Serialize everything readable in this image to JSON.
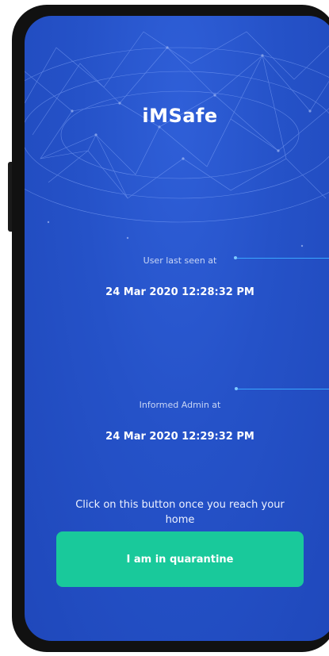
{
  "app": {
    "title": "iMSafe"
  },
  "last_seen": {
    "label": "User last seen at",
    "value": "24 Mar 2020 12:28:32 PM"
  },
  "admin": {
    "label": "Informed Admin at",
    "value": "24 Mar 2020 12:29:32 PM"
  },
  "instruction": {
    "text": "Click on this button once you reach your home"
  },
  "actions": {
    "quarantine_label": "I am in quarantine"
  },
  "colors": {
    "background": "#2552c8",
    "button": "#19c99b",
    "callout": "#3aa6ff"
  }
}
